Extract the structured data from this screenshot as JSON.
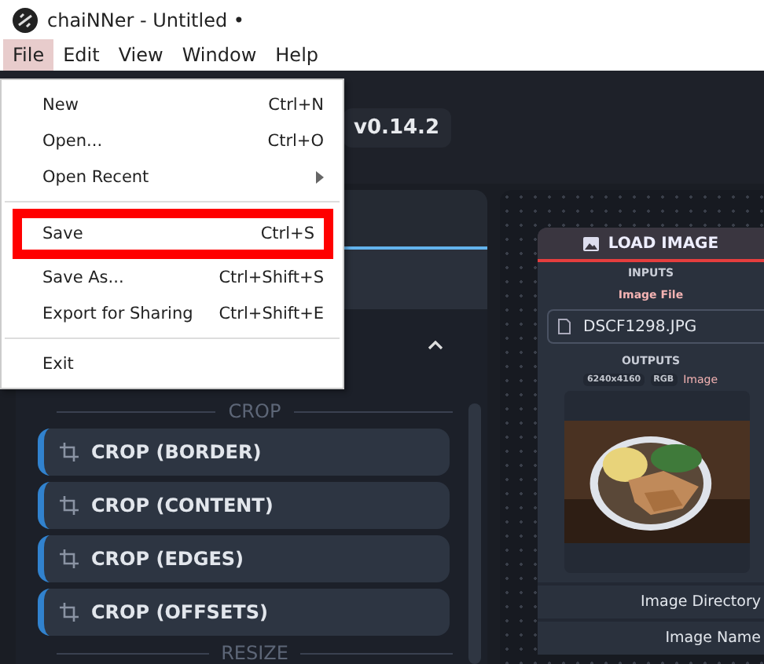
{
  "window": {
    "title": "chaiNNer - Untitled •"
  },
  "menubar": [
    {
      "label": "File",
      "selected": true
    },
    {
      "label": "Edit",
      "selected": false
    },
    {
      "label": "View",
      "selected": false
    },
    {
      "label": "Window",
      "selected": false
    },
    {
      "label": "Help",
      "selected": false
    }
  ],
  "file_menu": [
    {
      "kind": "item",
      "label": "New",
      "shortcut": "Ctrl+N",
      "highlighted": false
    },
    {
      "kind": "item",
      "label": "Open...",
      "shortcut": "Ctrl+O",
      "highlighted": false
    },
    {
      "kind": "submenu",
      "label": "Open Recent",
      "highlighted": false
    },
    {
      "kind": "separator"
    },
    {
      "kind": "item",
      "label": "Save",
      "shortcut": "Ctrl+S",
      "highlighted": true
    },
    {
      "kind": "item",
      "label": "Save As...",
      "shortcut": "Ctrl+Shift+S",
      "highlighted": false
    },
    {
      "kind": "item",
      "label": "Export for Sharing",
      "shortcut": "Ctrl+Shift+E",
      "highlighted": false
    },
    {
      "kind": "separator"
    },
    {
      "kind": "item",
      "label": "Exit",
      "highlighted": false
    }
  ],
  "header": {
    "version": "v0.14.2"
  },
  "sidebar": {
    "sections": [
      {
        "title": "CROP",
        "items": [
          "CROP (BORDER)",
          "CROP (CONTENT)",
          "CROP (EDGES)",
          "CROP (OFFSETS)"
        ]
      },
      {
        "title": "RESIZE"
      }
    ]
  },
  "node": {
    "title": "LOAD IMAGE",
    "inputs_label": "INPUTS",
    "input_name": "Image File",
    "file": "DSCF1298.JPG",
    "outputs_label": "OUTPUTS",
    "tags": [
      "6240x4160",
      "RGB"
    ],
    "output_name": "Image",
    "extra_outputs": [
      "Image Directory",
      "Image Name"
    ]
  }
}
